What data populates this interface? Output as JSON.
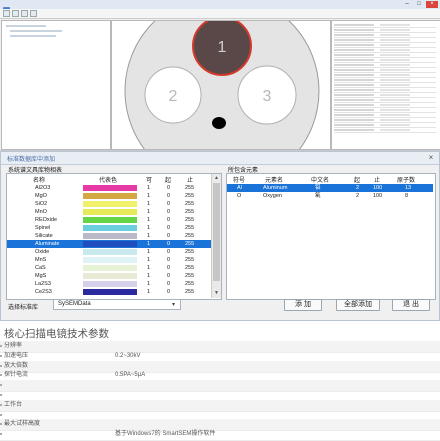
{
  "app": {
    "title": "",
    "canvas_labels": [
      "1",
      "2",
      "3"
    ],
    "colors": {
      "sample_disc": "#e4e4e4",
      "zone_1": "#5a4848",
      "zone_1_border": "#d23b2b",
      "zone_marker": "#000000"
    }
  },
  "dialog": {
    "title": "标准数据库中添加",
    "left_group_label": "系统谱文具库物相表",
    "right_group_label": "所包含元素",
    "element_table": {
      "headers": [
        "名称",
        "代表色",
        "可",
        "起",
        "止"
      ],
      "rows": [
        {
          "name": "Al2O3",
          "color": "#e63aa6",
          "a": "1",
          "b": "0",
          "c": "255",
          "selected": false
        },
        {
          "name": "MgO",
          "color": "#d4a843",
          "a": "1",
          "b": "0",
          "c": "255",
          "selected": false
        },
        {
          "name": "SiO2",
          "color": "#f1f06a",
          "a": "1",
          "b": "0",
          "c": "255",
          "selected": false
        },
        {
          "name": "MnO",
          "color": "#e6ea59",
          "a": "1",
          "b": "0",
          "c": "255",
          "selected": false
        },
        {
          "name": "REOxide",
          "color": "#66d447",
          "a": "1",
          "b": "0",
          "c": "255",
          "selected": false
        },
        {
          "name": "Spinel",
          "color": "#6ccfe0",
          "a": "1",
          "b": "0",
          "c": "255",
          "selected": false
        },
        {
          "name": "Silicate",
          "color": "#b9b9c7",
          "a": "1",
          "b": "0",
          "c": "255",
          "selected": false
        },
        {
          "name": "Aluminate",
          "color": "#1f4fbf",
          "a": "1",
          "b": "0",
          "c": "255",
          "selected": true
        },
        {
          "name": "Oxide",
          "color": "#c9e9ee",
          "a": "1",
          "b": "0",
          "c": "255",
          "selected": false
        },
        {
          "name": "MnS",
          "color": "#dff2f6",
          "a": "1",
          "b": "0",
          "c": "255",
          "selected": false
        },
        {
          "name": "CaS",
          "color": "#e7f1d6",
          "a": "1",
          "b": "0",
          "c": "255",
          "selected": false
        },
        {
          "name": "MgS",
          "color": "#e9ead5",
          "a": "1",
          "b": "0",
          "c": "255",
          "selected": false
        },
        {
          "name": "La2S3",
          "color": "#d6d0ea",
          "a": "1",
          "b": "0",
          "c": "255",
          "selected": false
        },
        {
          "name": "Ce2S3",
          "color": "#2a2a9e",
          "a": "1",
          "b": "0",
          "c": "255",
          "selected": false
        }
      ]
    },
    "selected_table": {
      "headers": [
        "符号",
        "元素名",
        "中文名",
        "起",
        "止",
        "原子数"
      ],
      "rows": [
        {
          "symbol": "Al",
          "name": "Aluminum",
          "cn": "铝",
          "start": "2",
          "end": "100",
          "atoms": "13",
          "selected": true
        },
        {
          "symbol": "O",
          "name": "Oxygen",
          "cn": "氧",
          "start": "2",
          "end": "100",
          "atoms": "8",
          "selected": false
        }
      ]
    },
    "standard_label": "选择标准库",
    "standard_value": "SySEMData",
    "buttons": {
      "add": "添 加",
      "add_all": "全部添加",
      "exit": "退 出"
    }
  },
  "spec": {
    "title": "核心扫描电镜技术参数",
    "rows": [
      {
        "key": "分辨率",
        "value": ""
      },
      {
        "key": "加速电压",
        "value": "0.2~30kV"
      },
      {
        "key": "放大倍数",
        "value": ""
      },
      {
        "key": "探针电流",
        "value": "0.5PA~5μA"
      },
      {
        "key": "",
        "value": ""
      },
      {
        "key": "",
        "value": ""
      },
      {
        "key": "工作台",
        "value": ""
      },
      {
        "key": "",
        "value": ""
      },
      {
        "key": "最大试样高度",
        "value": ""
      },
      {
        "key": "",
        "value": "基于Windows7的 SmartSEM操作软件"
      }
    ]
  }
}
